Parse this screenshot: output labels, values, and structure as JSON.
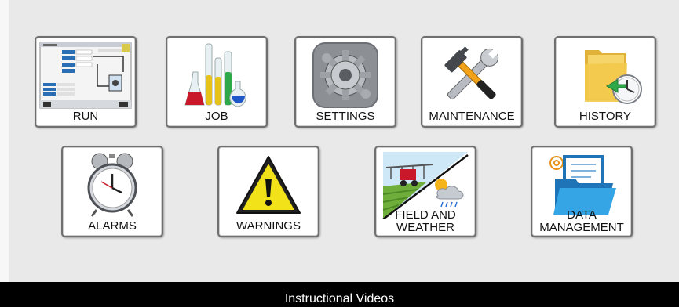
{
  "menu": {
    "row1": [
      {
        "label": "RUN",
        "icon": "run-screen-icon"
      },
      {
        "label": "JOB",
        "icon": "lab-flasks-icon"
      },
      {
        "label": "SETTINGS",
        "icon": "gear-icon"
      },
      {
        "label": "MAINTENANCE",
        "icon": "hammer-wrench-icon"
      },
      {
        "label": "HISTORY",
        "icon": "folder-clock-icon"
      }
    ],
    "row2": [
      {
        "label": "ALARMS",
        "icon": "alarm-clock-icon"
      },
      {
        "label": "WARNINGS",
        "icon": "warning-triangle-icon"
      },
      {
        "label_line1": "FIELD AND",
        "label_line2": "WEATHER",
        "icon": "field-weather-icon"
      },
      {
        "label_line1": "DATA",
        "label_line2": "MANAGEMENT",
        "icon": "data-folder-icon"
      }
    ]
  },
  "footer": {
    "label": "Instructional Videos"
  },
  "colors": {
    "background": "#e9e9e9",
    "tile_border": "#6f6f6f",
    "footer_bg": "#000000",
    "footer_text": "#ffffff"
  }
}
